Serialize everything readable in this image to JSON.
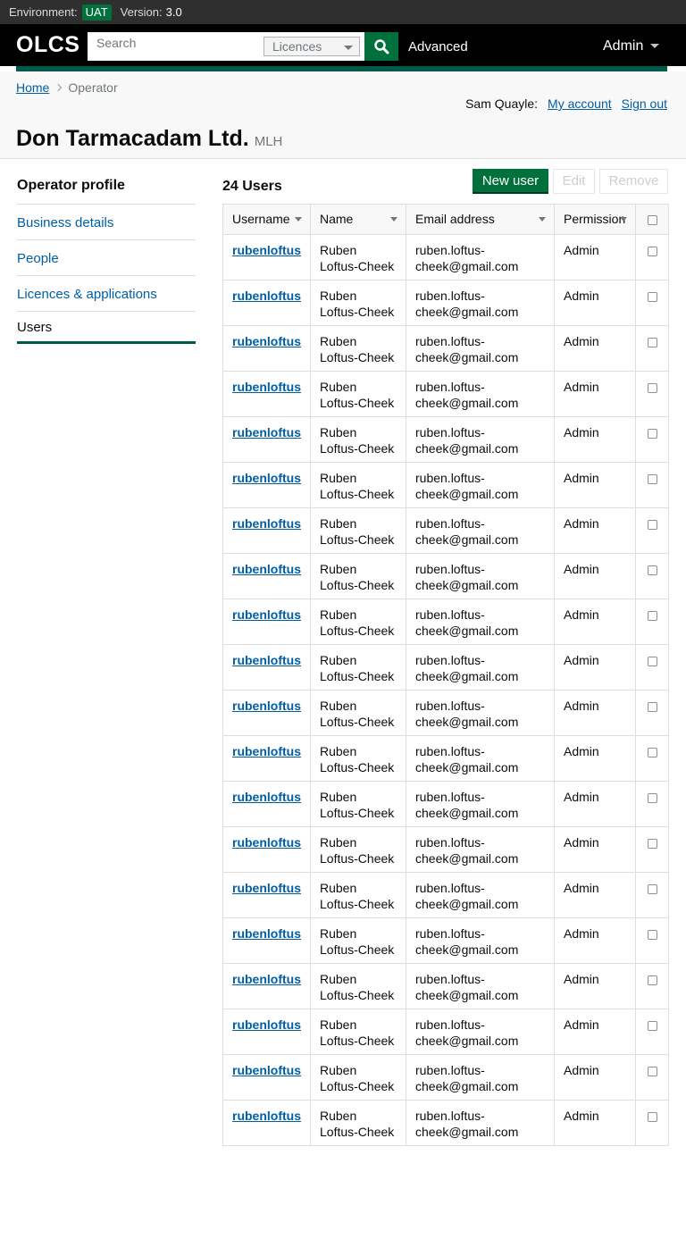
{
  "env": {
    "label": "Environment:",
    "badge": "UAT",
    "version_label": "Version:",
    "version": "3.0"
  },
  "header": {
    "logo": "OLCS",
    "search_placeholder": "Search",
    "search_scope": "Licences",
    "advanced": "Advanced",
    "admin": "Admin"
  },
  "breadcrumb": {
    "home": "Home",
    "current": "Operator"
  },
  "account": {
    "user": "Sam Quayle:",
    "my_account": "My account",
    "sign_out": "Sign out"
  },
  "page": {
    "title": "Don Tarmacadam Ltd.",
    "licence": "MLH"
  },
  "sidebar": {
    "heading": "Operator profile",
    "items": [
      {
        "label": "Business details"
      },
      {
        "label": "People"
      },
      {
        "label": "Licences & applications"
      },
      {
        "label": "Users"
      }
    ]
  },
  "users": {
    "count_label": "24 Users",
    "new_user": "New user",
    "edit": "Edit",
    "remove": "Remove",
    "columns": [
      "Username",
      "Name",
      "Email address",
      "Permission"
    ],
    "rows": [
      {
        "username": "rubenloftus",
        "name1": "Ruben",
        "name2": "Loftus-Cheek",
        "email1": "ruben.loftus-",
        "email2": "cheek@gmail.com",
        "permission": "Admin"
      },
      {
        "username": "rubenloftus",
        "name1": "Ruben",
        "name2": "Loftus-Cheek",
        "email1": "ruben.loftus-",
        "email2": "cheek@gmail.com",
        "permission": "Admin"
      },
      {
        "username": "rubenloftus",
        "name1": "Ruben",
        "name2": "Loftus-Cheek",
        "email1": "ruben.loftus-",
        "email2": "cheek@gmail.com",
        "permission": "Admin"
      },
      {
        "username": "rubenloftus",
        "name1": "Ruben",
        "name2": "Loftus-Cheek",
        "email1": "ruben.loftus-",
        "email2": "cheek@gmail.com",
        "permission": "Admin"
      },
      {
        "username": "rubenloftus",
        "name1": "Ruben",
        "name2": "Loftus-Cheek",
        "email1": "ruben.loftus-",
        "email2": "cheek@gmail.com",
        "permission": "Admin"
      },
      {
        "username": "rubenloftus",
        "name1": "Ruben",
        "name2": "Loftus-Cheek",
        "email1": "ruben.loftus-",
        "email2": "cheek@gmail.com",
        "permission": "Admin"
      },
      {
        "username": "rubenloftus",
        "name1": "Ruben",
        "name2": "Loftus-Cheek",
        "email1": "ruben.loftus-",
        "email2": "cheek@gmail.com",
        "permission": "Admin"
      },
      {
        "username": "rubenloftus",
        "name1": "Ruben",
        "name2": "Loftus-Cheek",
        "email1": "ruben.loftus-",
        "email2": "cheek@gmail.com",
        "permission": "Admin"
      },
      {
        "username": "rubenloftus",
        "name1": "Ruben",
        "name2": "Loftus-Cheek",
        "email1": "ruben.loftus-",
        "email2": "cheek@gmail.com",
        "permission": "Admin"
      },
      {
        "username": "rubenloftus",
        "name1": "Ruben",
        "name2": "Loftus-Cheek",
        "email1": "ruben.loftus-",
        "email2": "cheek@gmail.com",
        "permission": "Admin"
      },
      {
        "username": "rubenloftus",
        "name1": "Ruben",
        "name2": "Loftus-Cheek",
        "email1": "ruben.loftus-",
        "email2": "cheek@gmail.com",
        "permission": "Admin"
      },
      {
        "username": "rubenloftus",
        "name1": "Ruben",
        "name2": "Loftus-Cheek",
        "email1": "ruben.loftus-",
        "email2": "cheek@gmail.com",
        "permission": "Admin"
      },
      {
        "username": "rubenloftus",
        "name1": "Ruben",
        "name2": "Loftus-Cheek",
        "email1": "ruben.loftus-",
        "email2": "cheek@gmail.com",
        "permission": "Admin"
      },
      {
        "username": "rubenloftus",
        "name1": "Ruben",
        "name2": "Loftus-Cheek",
        "email1": "ruben.loftus-",
        "email2": "cheek@gmail.com",
        "permission": "Admin"
      },
      {
        "username": "rubenloftus",
        "name1": "Ruben",
        "name2": "Loftus-Cheek",
        "email1": "ruben.loftus-",
        "email2": "cheek@gmail.com",
        "permission": "Admin"
      },
      {
        "username": "rubenloftus",
        "name1": "Ruben",
        "name2": "Loftus-Cheek",
        "email1": "ruben.loftus-",
        "email2": "cheek@gmail.com",
        "permission": "Admin"
      },
      {
        "username": "rubenloftus",
        "name1": "Ruben",
        "name2": "Loftus-Cheek",
        "email1": "ruben.loftus-",
        "email2": "cheek@gmail.com",
        "permission": "Admin"
      },
      {
        "username": "rubenloftus",
        "name1": "Ruben",
        "name2": "Loftus-Cheek",
        "email1": "ruben.loftus-",
        "email2": "cheek@gmail.com",
        "permission": "Admin"
      },
      {
        "username": "rubenloftus",
        "name1": "Ruben",
        "name2": "Loftus-Cheek",
        "email1": "ruben.loftus-",
        "email2": "cheek@gmail.com",
        "permission": "Admin"
      },
      {
        "username": "rubenloftus",
        "name1": "Ruben",
        "name2": "Loftus-Cheek",
        "email1": "ruben.loftus-",
        "email2": "cheek@gmail.com",
        "permission": "Admin"
      }
    ]
  },
  "colors": {
    "brand_green": "#00703c",
    "accent_teal": "#005a4a",
    "link_blue": "#005ea5"
  }
}
